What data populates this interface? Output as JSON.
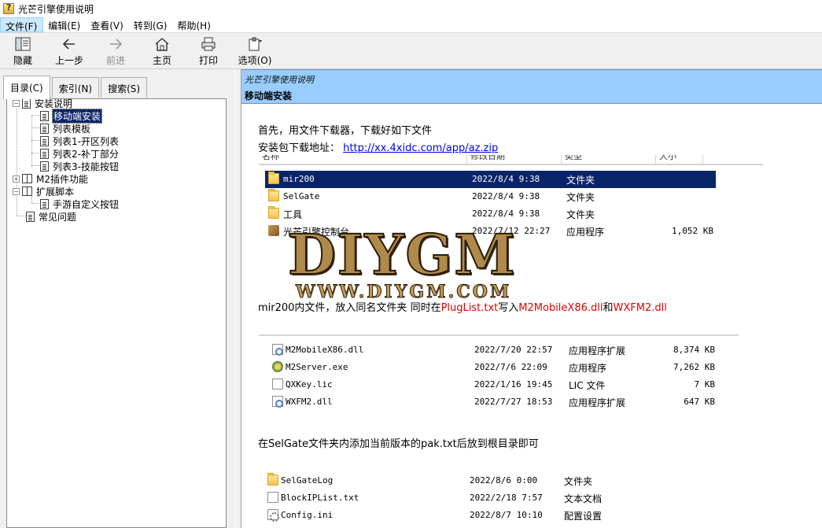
{
  "window": {
    "title": "光芒引擎使用说明"
  },
  "menu": [
    {
      "label": "文件(F)",
      "active": true
    },
    {
      "label": "编辑(E)"
    },
    {
      "label": "查看(V)"
    },
    {
      "label": "转到(G)"
    },
    {
      "label": "帮助(H)"
    }
  ],
  "toolbar": {
    "hide": "隐藏",
    "back": "上一步",
    "forward": "前进",
    "home": "主页",
    "print": "打印",
    "options": "选项(O)"
  },
  "tabs": {
    "contents": "目录(C)",
    "index": "索引(N)",
    "search": "搜索(S)"
  },
  "tree": {
    "install": "安装说明",
    "mobile_install": "移动端安装",
    "list_template": "列表模板",
    "list1": "列表1-开区列表",
    "list2": "列表2-补丁部分",
    "list3": "列表3-技能按钮",
    "m2_plugin": "M2插件功能",
    "ext_script": "扩展脚本",
    "custom_buttons": "手游自定义按钮",
    "faq": "常见问题"
  },
  "topic": {
    "breadcrumb": "光芒引擎使用说明",
    "title": "移动端安装"
  },
  "body": {
    "intro": "首先，用文件下载器，下载好如下文件",
    "download_label": "安装包下载地址：",
    "download_url": "http://xx.4xidc.com/app/az.zip",
    "step2_a": "mir200内文件，放入同名文件夹 同时在",
    "step2_plug": "PlugList.txt",
    "step2_b": "写入",
    "step2_dll1": "M2MobileX86.dll",
    "step2_c": "和",
    "step2_dll2": "WXFM2.dll",
    "step3": "在SelGate文件夹内添加当前版本的pak.txt后放到根目录即可"
  },
  "explorer1": {
    "headers": [
      "名称",
      "修改日期",
      "类型",
      "大小"
    ],
    "rows": [
      {
        "name": "mir200",
        "date": "2022/8/4 9:38",
        "type": "文件夹",
        "size": "",
        "icon": "folder-icon"
      },
      {
        "name": "SelGate",
        "date": "2022/8/4 9:38",
        "type": "文件夹",
        "size": "",
        "icon": "folder-icon"
      },
      {
        "name": "工具",
        "date": "2022/8/4 9:38",
        "type": "文件夹",
        "size": "",
        "icon": "folder-icon"
      },
      {
        "name": "光芒引擎控制台",
        "date": "2022/7/12 22:27",
        "type": "应用程序",
        "size": "1,052 KB",
        "icon": "app-icon"
      }
    ]
  },
  "explorer2": {
    "rows": [
      {
        "name": "M2MobileX86.dll",
        "date": "2022/7/20 22:57",
        "type": "应用程序扩展",
        "size": "8,374 KB",
        "icon": "dll-icon"
      },
      {
        "name": "M2Server.exe",
        "date": "2022/7/6 22:09",
        "type": "应用程序",
        "size": "7,262 KB",
        "icon": "exe-icon"
      },
      {
        "name": "QXKey.lic",
        "date": "2022/1/16 19:45",
        "type": "LIC 文件",
        "size": "7 KB",
        "icon": "doc-icon"
      },
      {
        "name": "WXFM2.dll",
        "date": "2022/7/27 18:53",
        "type": "应用程序扩展",
        "size": "647 KB",
        "icon": "dll-icon"
      }
    ]
  },
  "explorer3": {
    "rows": [
      {
        "name": "SelGateLog",
        "date": "2022/8/6 0:00",
        "type": "文件夹",
        "icon": "folder-icon"
      },
      {
        "name": "BlockIPList.txt",
        "date": "2022/2/18 7:57",
        "type": "文本文档",
        "icon": "doc-icon"
      },
      {
        "name": "Config.ini",
        "date": "2022/8/7 10:10",
        "type": "配置设置",
        "icon": "config-icon"
      }
    ]
  },
  "watermark": {
    "main": "DIYGM",
    "url": "WWW.DIYGM.COM"
  }
}
